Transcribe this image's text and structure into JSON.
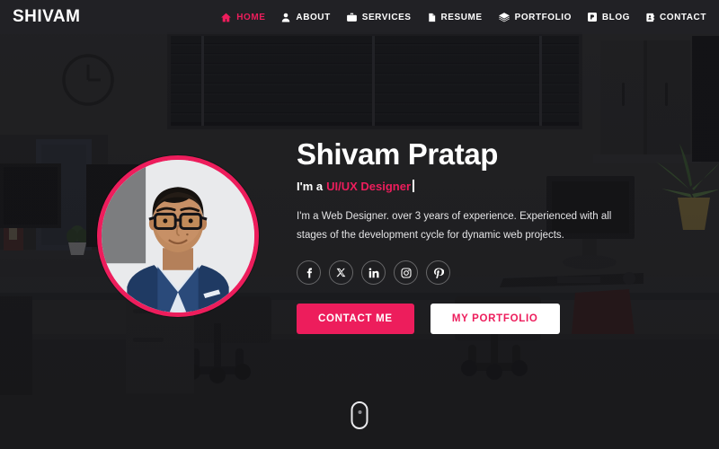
{
  "header": {
    "logo": "SHIVAM",
    "nav": [
      {
        "label": "HOME",
        "icon": "home-icon",
        "active": true
      },
      {
        "label": "ABOUT",
        "icon": "user-icon",
        "active": false
      },
      {
        "label": "SERVICES",
        "icon": "briefcase-icon",
        "active": false
      },
      {
        "label": "RESUME",
        "icon": "document-icon",
        "active": false
      },
      {
        "label": "PORTFOLIO",
        "icon": "layers-icon",
        "active": false
      },
      {
        "label": "BLOG",
        "icon": "blog-icon",
        "active": false
      },
      {
        "label": "CONTACT",
        "icon": "address-book-icon",
        "active": false
      }
    ]
  },
  "hero": {
    "avatar_alt": "profile-photo",
    "name": "Shivam Pratap",
    "role_prefix": "I'm a",
    "role_highlight": "UI/UX Designer",
    "description": "I'm a Web Designer. over 3 years of experience. Experienced with all stages of the development cycle for dynamic web projects.",
    "socials": [
      {
        "name": "facebook-icon",
        "label": "Facebook"
      },
      {
        "name": "x-icon",
        "label": "X"
      },
      {
        "name": "linkedin-icon",
        "label": "LinkedIn"
      },
      {
        "name": "instagram-icon",
        "label": "Instagram"
      },
      {
        "name": "pinterest-icon",
        "label": "Pinterest"
      }
    ],
    "buttons": {
      "contact": "CONTACT ME",
      "portfolio": "MY PORTFOLIO"
    }
  },
  "scroll_indicator": {
    "name": "scroll-mouse-icon"
  },
  "colors": {
    "accent": "#ed1d5c",
    "header_bg": "#222225",
    "text_light": "#ffffff",
    "scene_wall": "#37373a",
    "scene_floor": "#2e2e31"
  }
}
